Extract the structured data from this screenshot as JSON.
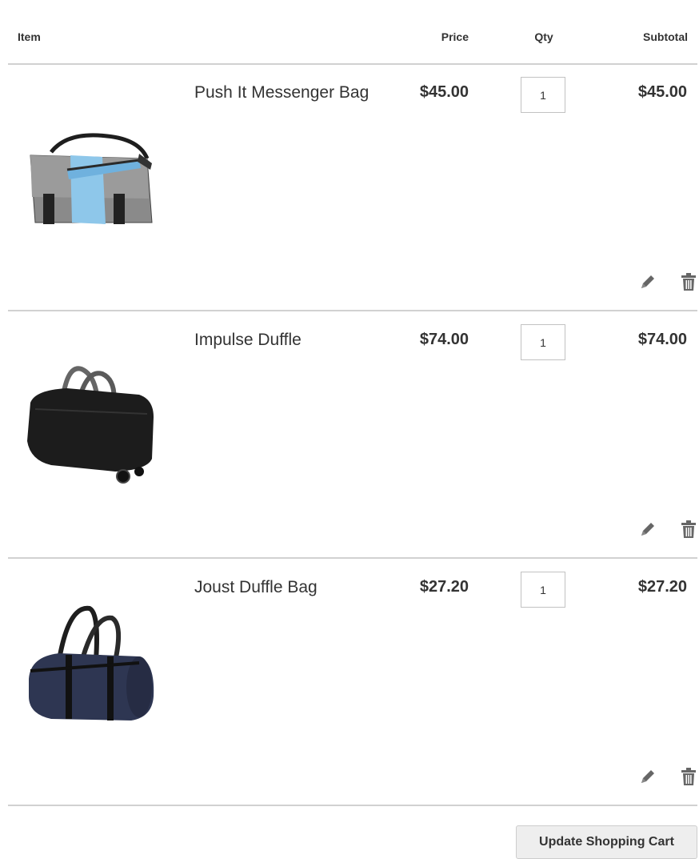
{
  "table": {
    "headers": {
      "item": "Item",
      "price": "Price",
      "qty": "Qty",
      "subtotal": "Subtotal"
    },
    "rows": [
      {
        "name": "Push It Messenger Bag",
        "price": "$45.00",
        "qty": "1",
        "subtotal": "$45.00",
        "image": "messenger-bag-image"
      },
      {
        "name": "Impulse Duffle",
        "price": "$74.00",
        "qty": "1",
        "subtotal": "$74.00",
        "image": "duffle-bag-image"
      },
      {
        "name": "Joust Duffle Bag",
        "price": "$27.20",
        "qty": "1",
        "subtotal": "$27.20",
        "image": "navy-duffle-bag-image"
      }
    ]
  },
  "actions": {
    "edit_icon": "pencil-icon",
    "delete_icon": "trash-icon",
    "update_label": "Update Shopping Cart"
  },
  "colors": {
    "divider": "#d1d1d1",
    "text": "#333333",
    "button_bg": "#eeeeee",
    "icon": "#666666"
  }
}
